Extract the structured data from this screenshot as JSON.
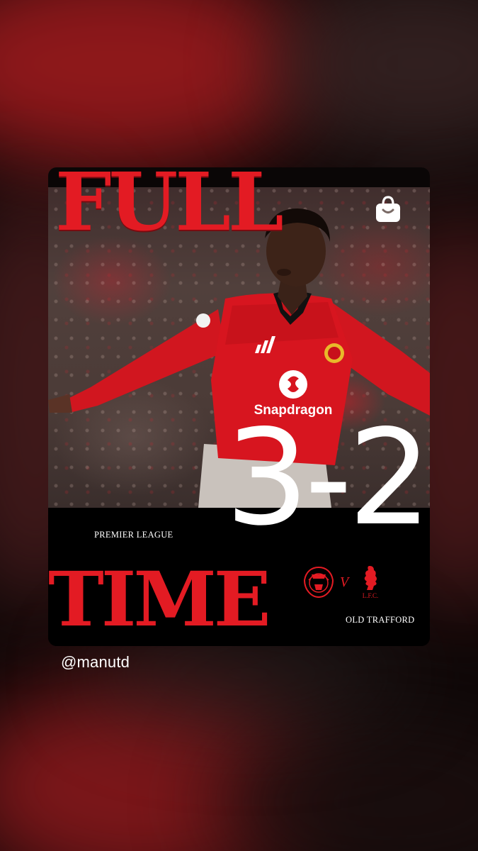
{
  "post": {
    "headline_top": "FULL",
    "headline_bottom": "TIME",
    "score": "3-2",
    "competition": "PREMIER LEAGUE",
    "versus": "V",
    "venue": "OLD TRAFFORD",
    "home_crest": "manchester-united-crest",
    "away_crest": "liverpool-crest",
    "away_crest_text": "L.F.C.",
    "shirt_sponsor": "Snapdragon"
  },
  "story": {
    "account_handle": "@manutd",
    "shop_icon": "shopping-bag-icon"
  },
  "colors": {
    "accent_red": "#e31b23",
    "panel_black": "#000000",
    "text_white": "#ffffff"
  }
}
